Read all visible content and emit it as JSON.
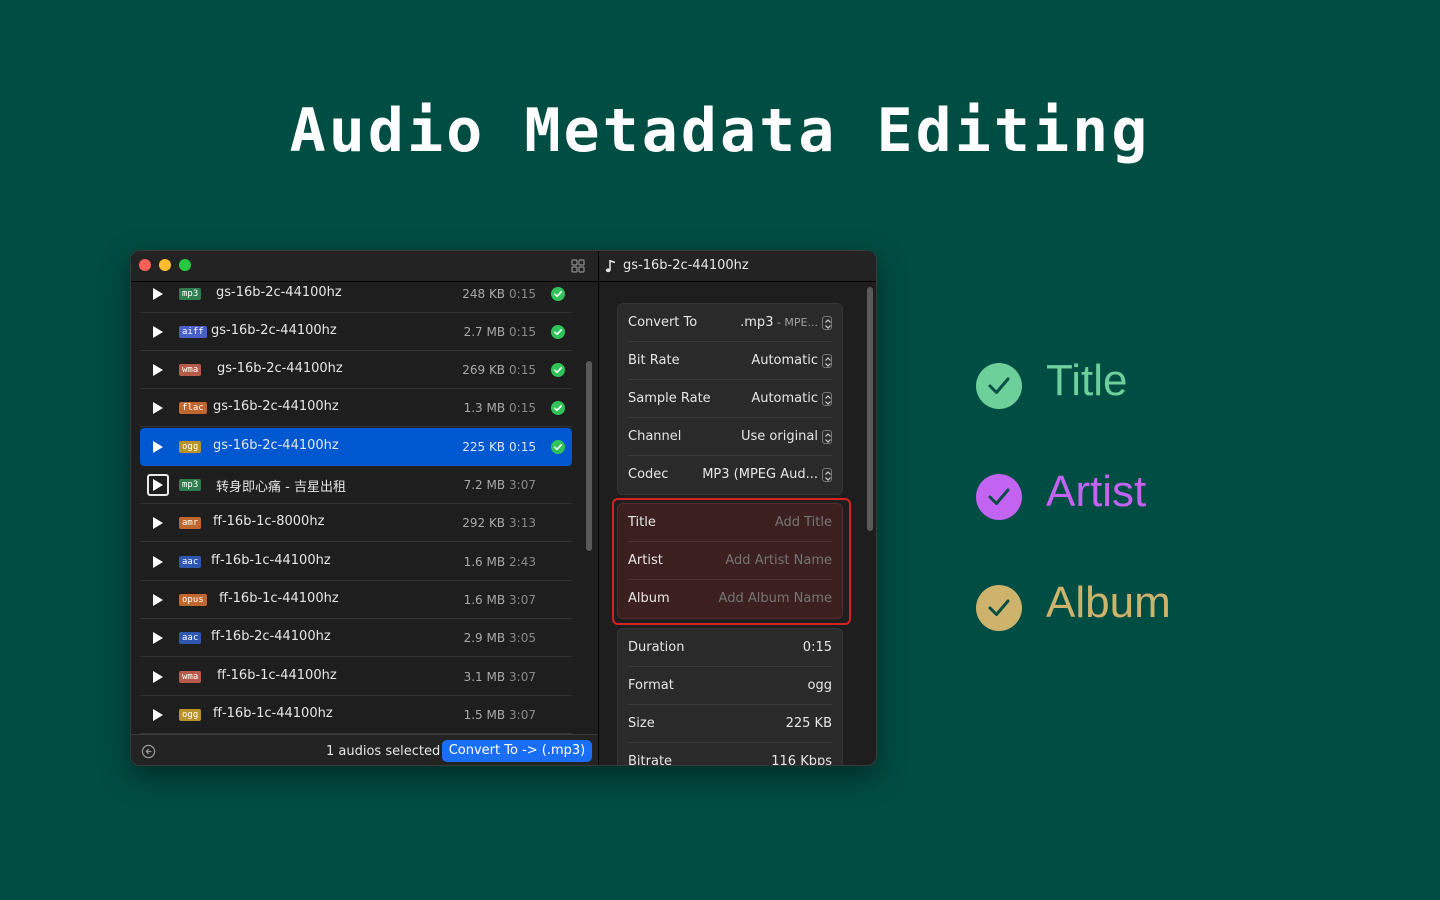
{
  "headline": "Audio Metadata Editing",
  "window": {
    "list": [
      {
        "format": "mp3",
        "format_color": "#2e7d4f",
        "name": "gs-16b-2c-44100hz",
        "size": "248 KB",
        "duration": "0:15",
        "done": true,
        "selected": false
      },
      {
        "format": "aiff",
        "format_color": "#4a5fc7",
        "name": "gs-16b-2c-44100hz",
        "size": "2.7 MB",
        "duration": "0:15",
        "done": true,
        "selected": false
      },
      {
        "format": "wma",
        "format_color": "#b85a4a",
        "name": "gs-16b-2c-44100hz",
        "size": "269 KB",
        "duration": "0:15",
        "done": true,
        "selected": false
      },
      {
        "format": "flac",
        "format_color": "#c0662f",
        "name": "gs-16b-2c-44100hz",
        "size": "1.3 MB",
        "duration": "0:15",
        "done": true,
        "selected": false
      },
      {
        "format": "ogg",
        "format_color": "#b8922a",
        "name": "gs-16b-2c-44100hz",
        "size": "225 KB",
        "duration": "0:15",
        "done": true,
        "selected": true
      },
      {
        "format": "mp3",
        "format_color": "#2e7d4f",
        "name": "转身即心痛 - 吉星出租",
        "size": "7.2 MB",
        "duration": "3:07",
        "done": false,
        "selected": false
      },
      {
        "format": "amr",
        "format_color": "#c0662f",
        "name": "ff-16b-1c-8000hz",
        "size": "292 KB",
        "duration": "3:13",
        "done": false,
        "selected": false
      },
      {
        "format": "aac",
        "format_color": "#2f57b0",
        "name": "ff-16b-1c-44100hz",
        "size": "1.6 MB",
        "duration": "2:43",
        "done": false,
        "selected": false
      },
      {
        "format": "opus",
        "format_color": "#c0662f",
        "name": "ff-16b-1c-44100hz",
        "size": "1.6 MB",
        "duration": "3:07",
        "done": false,
        "selected": false
      },
      {
        "format": "aac",
        "format_color": "#2f57b0",
        "name": "ff-16b-2c-44100hz",
        "size": "2.9 MB",
        "duration": "3:05",
        "done": false,
        "selected": false
      },
      {
        "format": "wma",
        "format_color": "#b85a4a",
        "name": "ff-16b-1c-44100hz",
        "size": "3.1 MB",
        "duration": "3:07",
        "done": false,
        "selected": false
      },
      {
        "format": "ogg",
        "format_color": "#b8922a",
        "name": "ff-16b-1c-44100hz",
        "size": "1.5 MB",
        "duration": "3:07",
        "done": false,
        "selected": false
      }
    ],
    "footer": {
      "selection_text": "1 audios selected",
      "convert_label": "Convert To -> (.mp3)"
    },
    "detail": {
      "title": "gs-16b-2c-44100hz",
      "settings": {
        "convert_to_label": "Convert To",
        "convert_to_value": ".mp3",
        "convert_to_sub": " - MPE...",
        "bit_rate_label": "Bit Rate",
        "bit_rate_value": "Automatic",
        "sample_rate_label": "Sample Rate",
        "sample_rate_value": "Automatic",
        "channel_label": "Channel",
        "channel_value": "Use original",
        "codec_label": "Codec",
        "codec_value": "MP3 (MPEG Aud..."
      },
      "metadata": {
        "title_label": "Title",
        "title_placeholder": "Add Title",
        "artist_label": "Artist",
        "artist_placeholder": "Add Artist Name",
        "album_label": "Album",
        "album_placeholder": "Add Album Name"
      },
      "info": {
        "duration_label": "Duration",
        "duration_value": "0:15",
        "format_label": "Format",
        "format_value": "ogg",
        "size_label": "Size",
        "size_value": "225 KB",
        "bitrate_label": "Bitrate",
        "bitrate_value": "116 Kbps"
      }
    }
  },
  "features": [
    {
      "label": "Title",
      "color": "#6dcf9a"
    },
    {
      "label": "Artist",
      "color": "#c263f2"
    },
    {
      "label": "Album",
      "color": "#cdb36b"
    }
  ],
  "colors": {
    "background": "#004d43",
    "accent": "#1a6ef5",
    "success": "#2fc35a",
    "highlight_border": "#d72020"
  }
}
